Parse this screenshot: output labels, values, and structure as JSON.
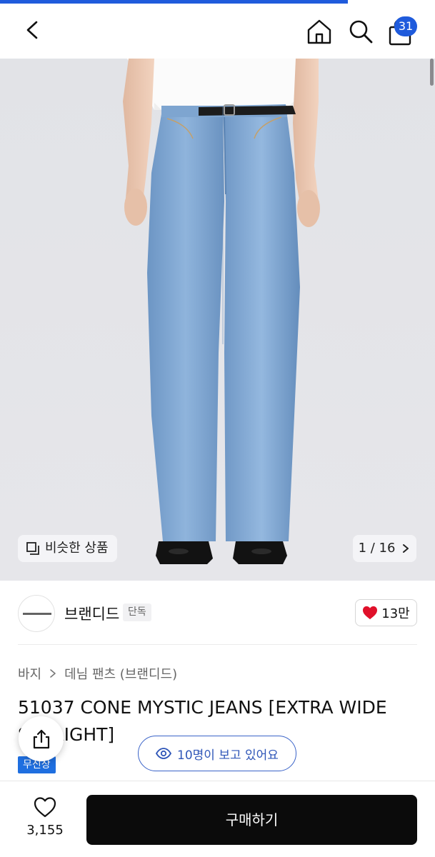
{
  "header": {
    "cart_count": "31"
  },
  "gallery": {
    "similar_label": "비슷한 상품",
    "page_indicator": "1 / 16"
  },
  "brand": {
    "name": "브랜디드",
    "tag": "단독",
    "likes": "13만"
  },
  "product": {
    "breadcrumb": [
      "바지",
      "데님 팬츠 (브랜디드)"
    ],
    "title": "51037 CONE MYSTIC JEANS [EXTRA WIDE STRAIGHT]",
    "badge": "무신상",
    "viewing": "10명이 보고 있어요"
  },
  "bottom": {
    "wish_count": "3,155",
    "buy_label": "구매하기"
  },
  "colors": {
    "accent": "#1f5bdc",
    "buy_button": "#0b0b0b",
    "heart": "#e0102a",
    "denim": "#7aa3cf"
  },
  "icons": [
    "back-arrow-icon",
    "home-icon",
    "search-icon",
    "shopping-bag-icon",
    "similar-items-icon",
    "chevron-right-icon",
    "heart-filled-icon",
    "share-icon",
    "eye-icon",
    "heart-outline-icon"
  ]
}
